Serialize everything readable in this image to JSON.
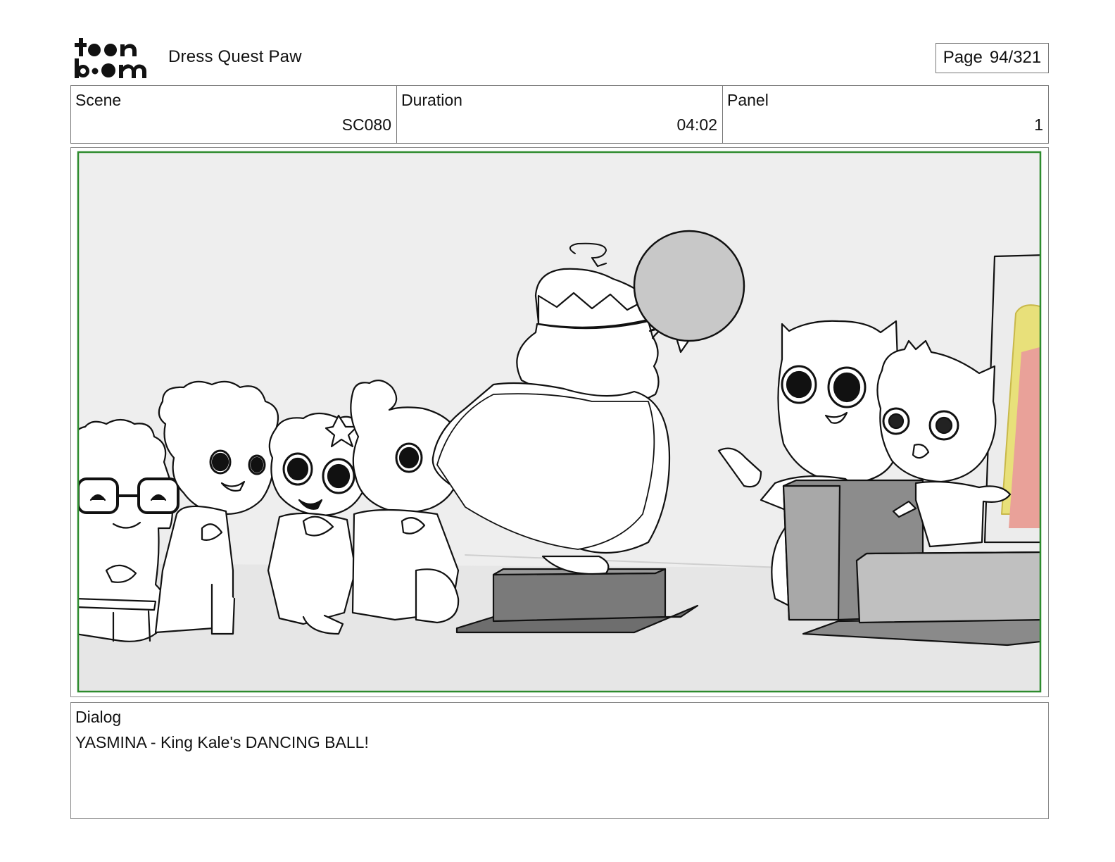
{
  "header": {
    "logo_text": "toon boom",
    "project_title": "Dress Quest Paw",
    "page_label": "Page",
    "page_number": "94/321"
  },
  "info": {
    "scene_label": "Scene",
    "scene_value": "SC080",
    "duration_label": "Duration",
    "duration_value": "04:02",
    "panel_label": "Panel",
    "panel_value": "1"
  },
  "dialog": {
    "label": "Dialog",
    "text": "YASMINA - King Kale's DANCING BALL!"
  },
  "colors": {
    "frame_border": "#888888",
    "safe_area": "#2e8b2e",
    "wall": "#eeeeee",
    "floor": "#e6e6e6",
    "dark_gray": "#707070",
    "mid_gray": "#9a9a9a",
    "ball": "#c8c8c8",
    "accent_yellow": "#e8e07a",
    "accent_pink": "#e9a199"
  }
}
